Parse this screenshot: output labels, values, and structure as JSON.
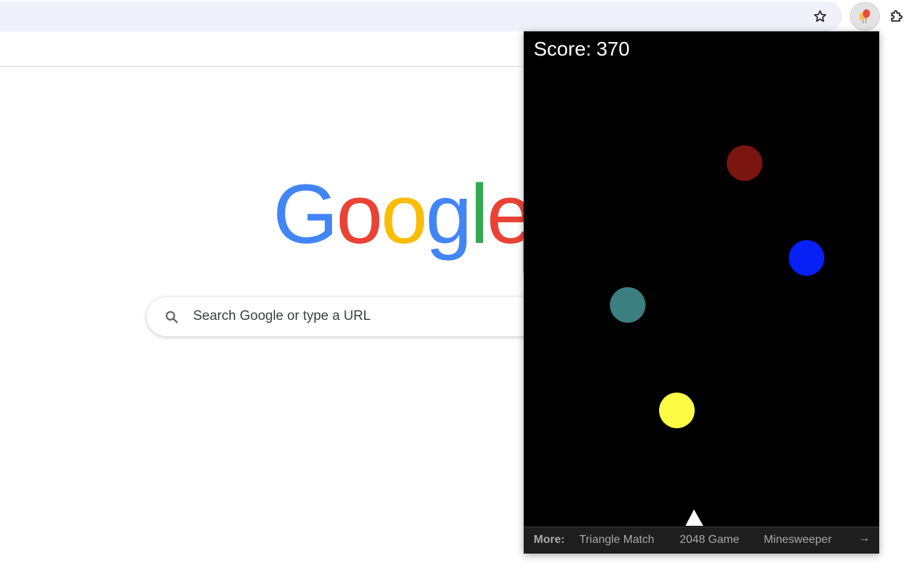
{
  "newtab": {
    "logo_text": "Google",
    "search_placeholder": "Search Google or type a URL"
  },
  "toolbar": {
    "icons": [
      "star-icon",
      "balloon-extension-icon",
      "puzzle-icon"
    ]
  },
  "popup": {
    "score_label": "Score:",
    "score_value": "370",
    "more_label": "More:",
    "more_links": [
      "Triangle Match",
      "2048 Game",
      "Minesweeper"
    ],
    "arrow": "→"
  },
  "game": {
    "balls": [
      {
        "color": "#7b1510"
      },
      {
        "color": "#0620f5"
      },
      {
        "color": "#3b7f80"
      },
      {
        "color": "#fefb45"
      }
    ],
    "shooter_color": "#ffffff"
  },
  "colors": {
    "google_blue": "#4285f4",
    "google_red": "#ea4335",
    "google_yellow": "#fbbc05",
    "google_green": "#34a853"
  }
}
